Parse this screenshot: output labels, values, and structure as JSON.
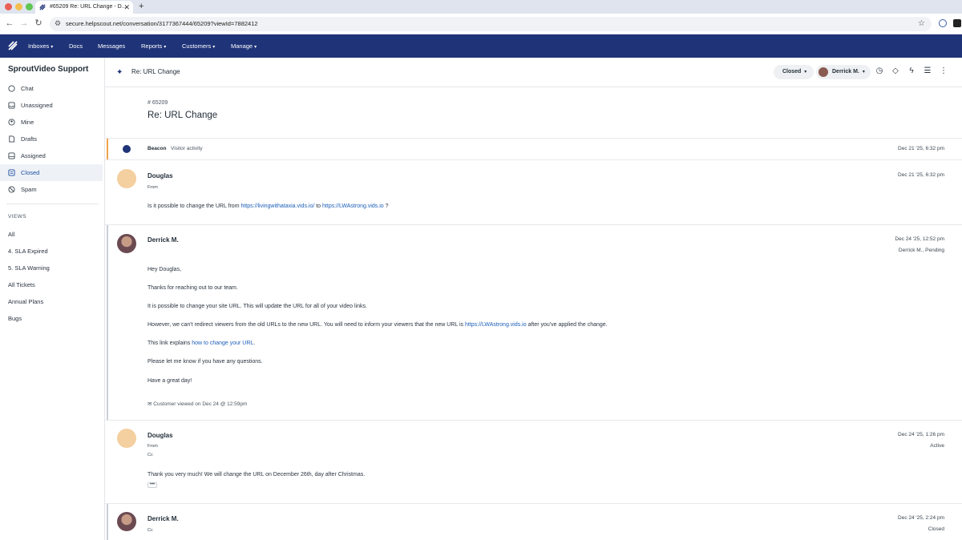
{
  "browser": {
    "tab_title": "#65209 Re: URL Change - D...",
    "url": "secure.helpscout.net/conversation/3177367444/65209?viewId=7882412"
  },
  "appnav": {
    "items": [
      {
        "label": "Inboxes",
        "dropdown": true
      },
      {
        "label": "Docs",
        "dropdown": false
      },
      {
        "label": "Messages",
        "dropdown": false
      },
      {
        "label": "Reports",
        "dropdown": true
      },
      {
        "label": "Customers",
        "dropdown": true
      },
      {
        "label": "Manage",
        "dropdown": true
      }
    ]
  },
  "sidebar": {
    "brand": "SproutVideo Support",
    "folders": [
      {
        "label": "Chat",
        "icon": "chat-icon"
      },
      {
        "label": "Unassigned",
        "icon": "inbox-icon"
      },
      {
        "label": "Mine",
        "icon": "person-icon"
      },
      {
        "label": "Drafts",
        "icon": "draft-icon"
      },
      {
        "label": "Assigned",
        "icon": "assigned-icon"
      },
      {
        "label": "Closed",
        "icon": "closed-icon",
        "active": true
      },
      {
        "label": "Spam",
        "icon": "spam-icon"
      }
    ],
    "views_heading": "VIEWS",
    "views": [
      "All",
      "4. SLA Expired",
      "5. SLA Warning",
      "All Tickets",
      "Annual Plans",
      "Bugs"
    ]
  },
  "conversation": {
    "header_title": "Re: URL Change",
    "status": "Closed",
    "assignee": "Derrick M.",
    "number": "65209",
    "title": "Re: URL Change",
    "beacon": {
      "label": "Beacon",
      "sub": "Visitor activity",
      "time": "Dec 21 '25, 6:32 pm"
    },
    "messages": [
      {
        "author": "Douglas",
        "time": "Dec 21 '25, 6:32 pm",
        "from_label": "From",
        "text_before": "Is it possible to change the URL from ",
        "link1": "https://livingwithataxia.vids.io/",
        "text_mid": " to ",
        "link2": "https://LWAstrong.vids.io",
        "text_after": " ?"
      },
      {
        "author": "Derrick M.",
        "time": "Dec 24 '25, 12:52 pm",
        "status_line": "Derrick M., Pending",
        "lines": {
          "greeting": "Hey Douglas,",
          "thanks": "Thanks for reaching out to our team.",
          "possible": "It is possible to change your site URL. This will update the URL for all of your video links.",
          "however_before": "However, we can't redirect viewers from the old URLs to the new URL. You will need to inform your viewers that the new URL is ",
          "however_link": "https://LWAstrong.vids.io",
          "however_after": " after you've applied the change.",
          "explain_before": "This link explains ",
          "explain_link": "how to change your URL",
          "explain_after": ".",
          "questions": "Please let me know if you have any questions.",
          "signoff": "Have a great day!"
        },
        "viewed": "Customer viewed on Dec 24 @ 12:59pm"
      },
      {
        "author": "Douglas",
        "time": "Dec 24 '25, 1:26 pm",
        "status_line": "Active",
        "from_label": "From",
        "cc_label": "Cc",
        "text": "Thank you very much! We will change the URL on December 26th, day after Christmas.",
        "more": "•••"
      },
      {
        "author": "Derrick M.",
        "time": "Dec 24 '25, 2:24 pm",
        "status_line": "Closed",
        "cc_label": "Cc"
      }
    ]
  },
  "colors": {
    "nav": "#1f3378",
    "accent": "#1c5fb8",
    "beacon_bar": "#f0a24a"
  }
}
